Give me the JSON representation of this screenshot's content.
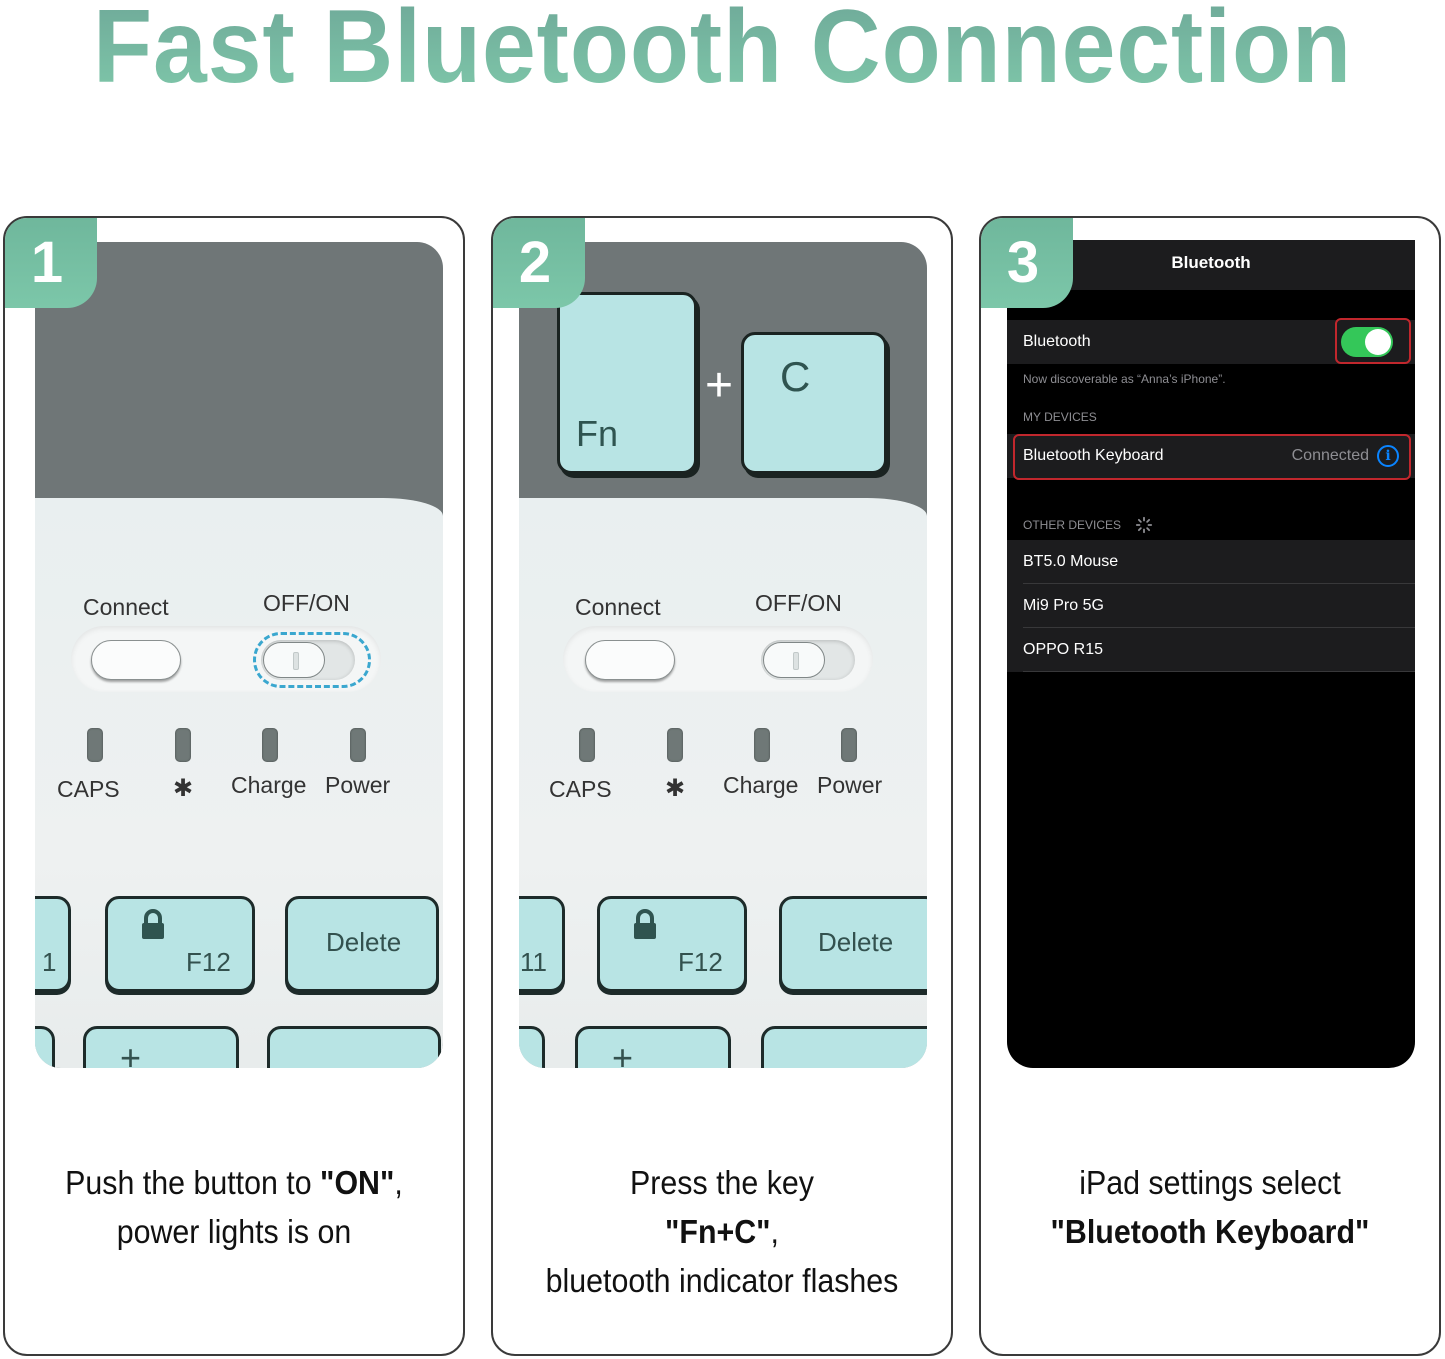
{
  "title": "Fast Bluetooth Connection",
  "colors": {
    "accent_green": "#7cc7a9",
    "keycap": "#b8e4e4",
    "highlight_dash": "#3aa7cf",
    "ios_toggle_on": "#34c759",
    "ios_info_blue": "#0a84ff",
    "highlight_red": "#c1272d"
  },
  "steps": [
    {
      "number": "1",
      "keyboard": {
        "connect_label": "Connect",
        "switch_label": "OFF/ON",
        "indicators": [
          "CAPS",
          "✱",
          "Charge",
          "Power"
        ],
        "keys": {
          "partial_left": "1",
          "f12": "F12",
          "delete": "Delete",
          "plus": "+"
        }
      },
      "caption": {
        "line1_prefix": "Push the button to ",
        "line1_bold": "\"ON\"",
        "line1_suffix": ",",
        "line2": "power lights is on"
      }
    },
    {
      "number": "2",
      "keyboard": {
        "fn_key": "Fn",
        "c_key": "C",
        "combo_plus": "+",
        "connect_label": "Connect",
        "switch_label": "OFF/ON",
        "indicators": [
          "CAPS",
          "✱",
          "Charge",
          "Power"
        ],
        "keys": {
          "partial_left": "11",
          "f12": "F12",
          "delete": "Delete",
          "plus": "+"
        }
      },
      "caption": {
        "line1": "Press the key",
        "line2_bold": "\"Fn+C\"",
        "line2_suffix": ",",
        "line3": "bluetooth indicator flashes"
      }
    },
    {
      "number": "3",
      "ios": {
        "nav_title": "Bluetooth",
        "bluetooth_row_label": "Bluetooth",
        "bluetooth_enabled": true,
        "discoverable_text": "Now discoverable as “Anna’s iPhone”.",
        "my_devices_header": "MY DEVICES",
        "my_devices": [
          {
            "name": "Bluetooth Keyboard",
            "status": "Connected"
          }
        ],
        "other_devices_header": "OTHER DEVICES",
        "other_devices": [
          "BT5.0 Mouse",
          "Mi9 Pro 5G",
          "OPPO R15"
        ]
      },
      "caption": {
        "line1": "iPad settings select",
        "line2_bold": "\"Bluetooth Keyboard\""
      }
    }
  ]
}
